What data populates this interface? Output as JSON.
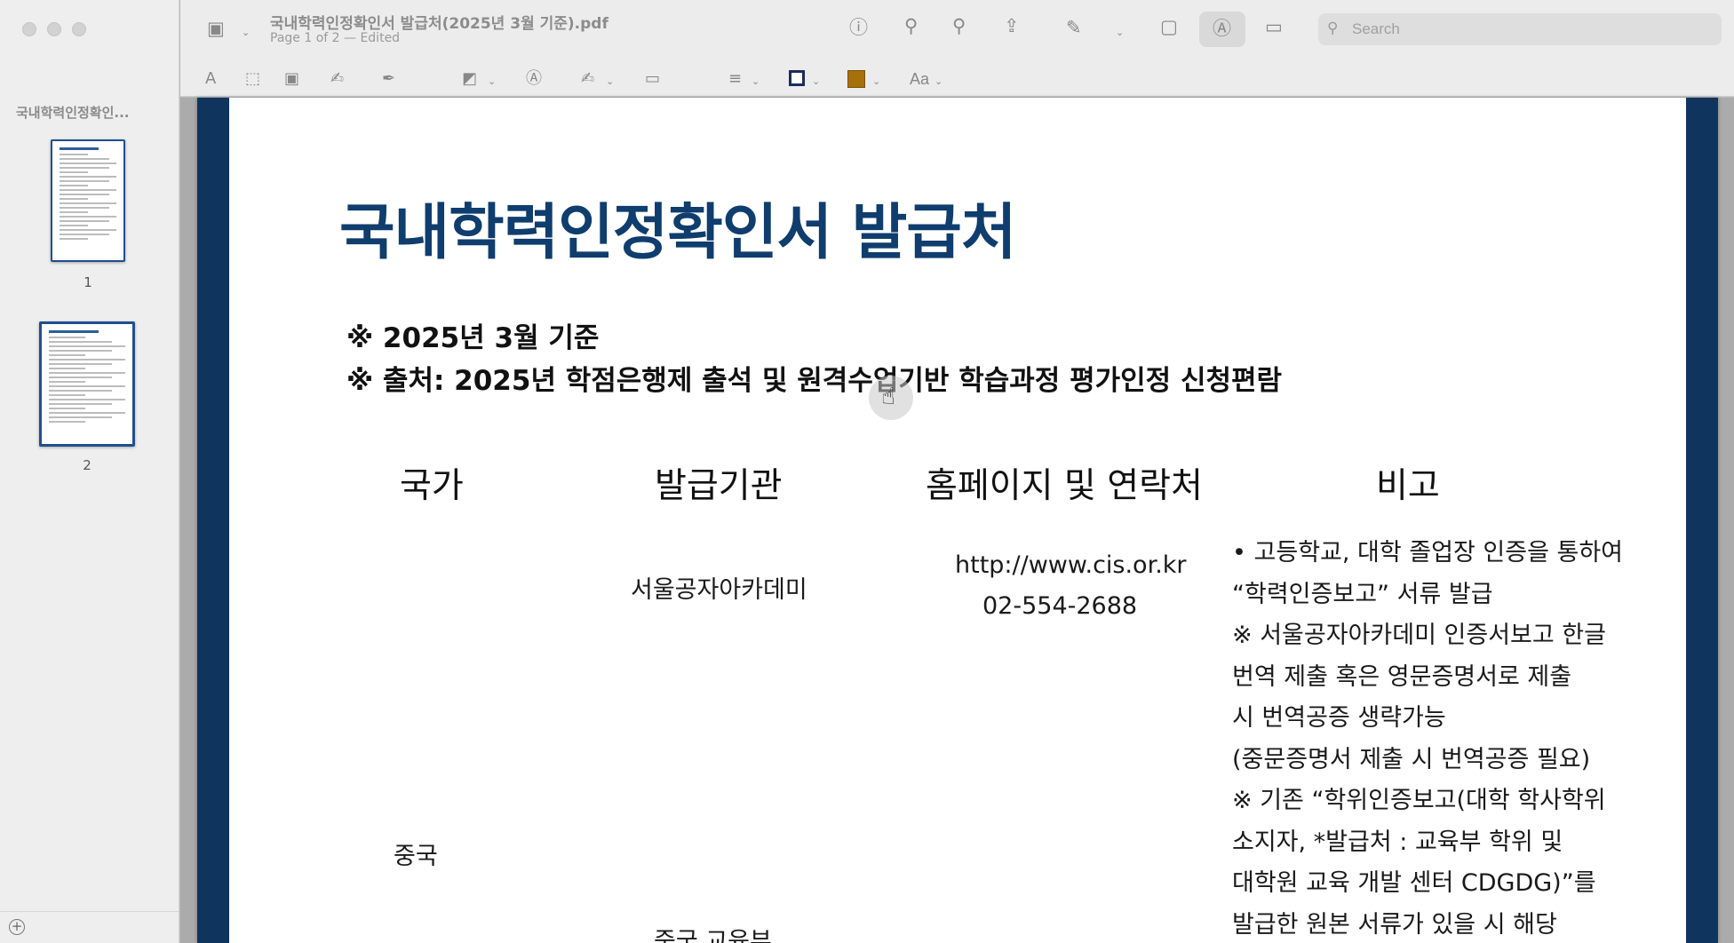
{
  "window": {
    "document_title": "국내학력인정확인서 발급처(2025년 3월 기준).pdf",
    "subtitle": "Page 1 of 2 — Edited"
  },
  "sidebar": {
    "title": "국내학력인정확인...",
    "thumbnails": [
      {
        "label": "1"
      },
      {
        "label": "2"
      }
    ]
  },
  "toolbar": {
    "search_placeholder": "Search",
    "text_style_label": "Aa",
    "stroke_color": "#1b2c5e",
    "fill_color": "#a6700a",
    "icons": [
      "sidebar-toggle-icon",
      "info-icon",
      "zoom-out-icon",
      "zoom-in-icon",
      "share-icon",
      "highlight-pen-icon",
      "rotate-icon",
      "markup-icon",
      "redact-icon",
      "search-icon",
      "text-selection-icon",
      "rect-selection-icon",
      "smart-lasso-icon",
      "sketch-icon",
      "draw-icon",
      "shapes-icon",
      "text-box-icon",
      "signature-icon",
      "note-icon",
      "line-style-icon",
      "border-color-icon",
      "fill-color-icon",
      "text-style-icon"
    ]
  },
  "document": {
    "title": "국내학력인정확인서 발급처",
    "notes": [
      "※ 2025년 3월 기준",
      "※ 출처: 2025년 학점은행제 출석 및 원격수업기반 학습과정 평가인정 신청편람"
    ],
    "table": {
      "headers": [
        "국가",
        "발급기관",
        "홈페이지 및 연락처",
        "비고"
      ],
      "row1": {
        "country": "중국",
        "institution": "서울공자아카데미",
        "url": "http://www.cis.or.kr",
        "phone": "02-554-2688",
        "remarks": [
          "• 고등학교, 대학 졸업장 인증을 통하여",
          "“학력인증보고” 서류 발급",
          "※ 서울공자아카데미 인증서보고 한글",
          "번역 제출 혹은 영문증명서로 제출",
          "시 번역공증 생략가능",
          "(중문증명서 제출 시 번역공증 필요)",
          "※ 기존 “학위인증보고(대학 학사학위",
          "소지자, *발급처 : 교육부 학위 및",
          "대학원 교육 개발 센터 CDGDG)”를",
          "발급한 원본 서류가 있을 시 해당"
        ]
      },
      "row2": {
        "institution": "중국 교육부"
      }
    }
  }
}
